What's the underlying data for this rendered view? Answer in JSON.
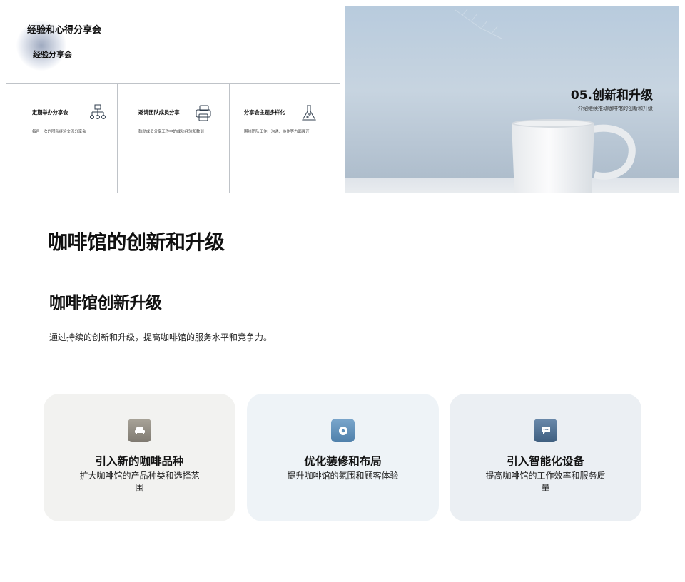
{
  "slide_top_left": {
    "title": "经验和心得分享会",
    "subtitle": "经验分享会",
    "items": [
      {
        "title": "定期举办分享会",
        "desc": "每月一次的团队经验交流分享会",
        "icon": "org-chart-icon"
      },
      {
        "title": "邀请团队成员分享",
        "desc": "鼓励成员分享工作中的成功经验和教训",
        "icon": "printer-icon"
      },
      {
        "title": "分享会主题多样化",
        "desc": "围绕团队工作、沟通、协作等方面展开",
        "icon": "flask-icon"
      }
    ]
  },
  "slide_top_right": {
    "title": "05.创新和升级",
    "subtitle": "介绍继续推动咖啡馆的创新和升级",
    "colors": {
      "background": "#b8cbdd",
      "mug": "#f3f4f5"
    }
  },
  "main": {
    "title": "咖啡馆的创新和升级",
    "section_title": "咖啡馆创新升级",
    "section_desc": "通过持续的创新和升级，提高咖啡馆的服务水平和竞争力。",
    "cards": [
      {
        "title": "引入新的咖啡品种",
        "desc": "扩大咖啡馆的产品种类和选择范围",
        "icon": "sofa-icon",
        "icon_color": "#8f8a80",
        "background": "#f2f2f0"
      },
      {
        "title": "优化装修和布局",
        "desc": "提升咖啡馆的氛围和顾客体验",
        "icon": "record-icon",
        "icon_color": "#5e8fb8",
        "background": "#eef3f7"
      },
      {
        "title": "引入智能化设备",
        "desc": "提高咖啡馆的工作效率和服务质量",
        "icon": "chat-bubble-icon",
        "icon_color": "#4e6e90",
        "background": "#ebeff3"
      }
    ]
  }
}
